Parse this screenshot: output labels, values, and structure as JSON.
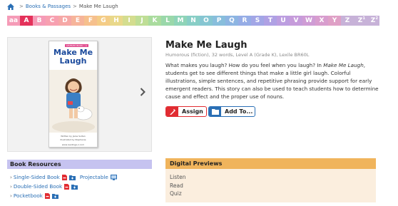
{
  "breadcrumb": {
    "home_icon": "home-icon",
    "separator": ">",
    "section": "Books & Passages",
    "current": "Make Me Laugh"
  },
  "levels": [
    {
      "label": "aa",
      "color": "#f59bb7"
    },
    {
      "label": "A",
      "color": "#e4315a",
      "selected": true
    },
    {
      "label": "B",
      "color": "#f59bb7"
    },
    {
      "label": "C",
      "color": "#f7a0b0"
    },
    {
      "label": "D",
      "color": "#f6a8a6"
    },
    {
      "label": "E",
      "color": "#f6b49a"
    },
    {
      "label": "F",
      "color": "#f6c08d"
    },
    {
      "label": "G",
      "color": "#f4cc86"
    },
    {
      "label": "H",
      "color": "#e9d88a"
    },
    {
      "label": "I",
      "color": "#d4dd8f"
    },
    {
      "label": "J",
      "color": "#bfde96"
    },
    {
      "label": "K",
      "color": "#aadc9e"
    },
    {
      "label": "L",
      "color": "#9ad8aa"
    },
    {
      "label": "M",
      "color": "#8fd4b8"
    },
    {
      "label": "N",
      "color": "#88cec6"
    },
    {
      "label": "O",
      "color": "#86c6d2"
    },
    {
      "label": "P",
      "color": "#88bedc"
    },
    {
      "label": "Q",
      "color": "#8db5e2"
    },
    {
      "label": "R",
      "color": "#96ade6"
    },
    {
      "label": "S",
      "color": "#a2a6e6"
    },
    {
      "label": "T",
      "color": "#afa1e4"
    },
    {
      "label": "U",
      "color": "#bc9ee0"
    },
    {
      "label": "V",
      "color": "#c69cdb"
    },
    {
      "label": "W",
      "color": "#cf9cd5"
    },
    {
      "label": "X",
      "color": "#d89dce"
    },
    {
      "label": "Y",
      "color": "#dfa0c6"
    },
    {
      "label": "Z",
      "color": "#c7b2d8"
    },
    {
      "label": "Z",
      "sup": "1",
      "color": "#c7b2d8"
    },
    {
      "label": "Z",
      "sup": "2",
      "color": "#c7b2d8"
    }
  ],
  "book": {
    "cover_title_line1": "Make Me",
    "cover_title_line2": "Laugh",
    "cover_level_label": "LEVELED BOOK • A",
    "cover_credits": "Written by Janie Sultan",
    "cover_credits2": "Illustrated by Stephanie",
    "cover_site": "www.readinga-z.com",
    "title": "Make Me Laugh",
    "meta": "Humorous (fiction), 32 words, Level A (Grade K), Lexile BR60L",
    "desc_part1": "What makes you laugh? How do you feel when you laugh? In ",
    "desc_italic": "Make Me Laugh",
    "desc_part2": ", students get to see different things that make a little girl laugh. Colorful illustrations, simple sentences, and repetitive phrasing provide support for early emergent readers. This story can also be used to teach students how to determine cause and effect and the proper use of nouns."
  },
  "actions": {
    "assign_label": "Assign",
    "add_label": "Add To..."
  },
  "resources": {
    "heading": "Book Resources",
    "items": [
      {
        "label": "Single-Sided Book",
        "extra": "Projectable"
      },
      {
        "label": "Double-Sided Book"
      },
      {
        "label": "Pocketbook"
      }
    ],
    "arrow": "›"
  },
  "digital_previews": {
    "heading": "Digital Previews",
    "items": [
      "Listen",
      "Read",
      "Quiz"
    ]
  },
  "colors": {
    "link": "#2a6fb5",
    "assign_red": "#e12c32",
    "resources_bg": "#c6c3f0",
    "previews_head": "#f0b45c",
    "previews_bg": "#fbeede"
  }
}
